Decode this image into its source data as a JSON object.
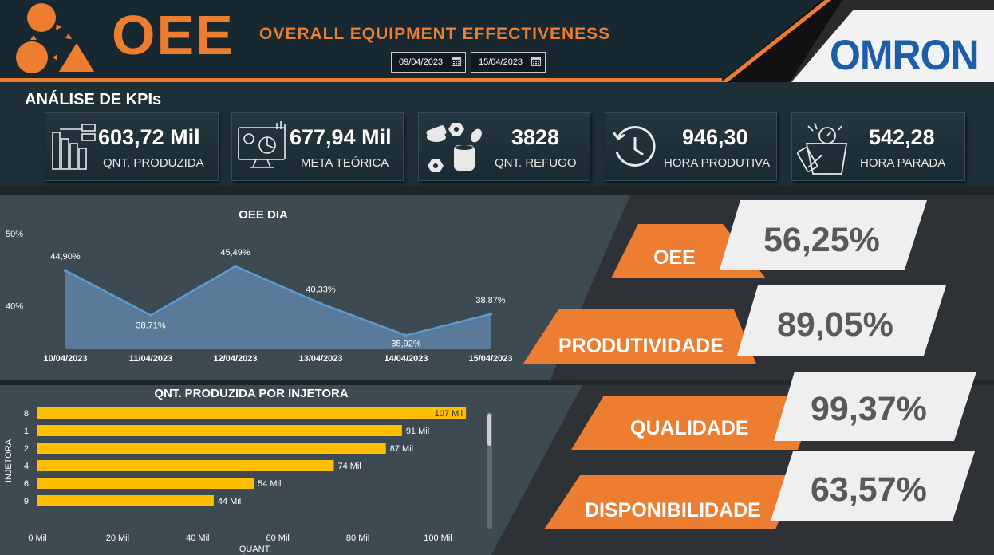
{
  "header": {
    "title": "OEE",
    "subtitle": "OVERALL EQUIPMENT EFFECTIVENESS",
    "date_start": "09/04/2023",
    "date_end": "15/04/2023",
    "brand": "OMRON",
    "accent_color": "#ed7d31",
    "brand_color": "#1d5ea8"
  },
  "kpis": {
    "title": "ANÁLISE DE KPIs",
    "cards": [
      {
        "value": "603,72 Mil",
        "label": "QNT. PRODUZIDA",
        "icon": "bar-chart-icon"
      },
      {
        "value": "677,94 Mil",
        "label": "META TEÓRICA",
        "icon": "monitor-chart-icon"
      },
      {
        "value": "3828",
        "label": "QNT. REFUGO",
        "icon": "parts-icon"
      },
      {
        "value": "946,30",
        "label": "HORA PRODUTIVA",
        "icon": "history-clock-icon"
      },
      {
        "value": "542,28",
        "label": "HORA PARADA",
        "icon": "stopwatch-icon"
      }
    ]
  },
  "chart_data": [
    {
      "type": "area",
      "title": "OEE DIA",
      "x": [
        "10/04/2023",
        "11/04/2023",
        "12/04/2023",
        "13/04/2023",
        "14/04/2023",
        "15/04/2023"
      ],
      "values": [
        44.9,
        38.71,
        45.49,
        40.33,
        35.92,
        38.87
      ],
      "data_labels": [
        "44,90%",
        "38,71%",
        "45,49%",
        "40,33%",
        "35,92%",
        "38,87%"
      ],
      "y_ticks": [
        "50%",
        "40%"
      ],
      "ylim": [
        34,
        50
      ],
      "grid": false,
      "color": "#5b9bd5"
    },
    {
      "type": "bar",
      "orientation": "horizontal",
      "title": "QNT. PRODUZIDA POR INJETORA",
      "xlabel": "QUANT.",
      "ylabel": "INJETORA",
      "categories": [
        "8",
        "1",
        "2",
        "4",
        "6",
        "9"
      ],
      "values": [
        107,
        91,
        87,
        74,
        54,
        44
      ],
      "data_labels": [
        "107 Mil",
        "91 Mil",
        "87 Mil",
        "74 Mil",
        "54 Mil",
        "44 Mil"
      ],
      "x_ticks": [
        "0 Mil",
        "20 Mil",
        "40 Mil",
        "60 Mil",
        "80 Mil",
        "100 Mil"
      ],
      "xlim": [
        0,
        107
      ],
      "grid": false,
      "color": "#ffbf00"
    }
  ],
  "metrics": [
    {
      "label": "OEE",
      "value": "56,25%"
    },
    {
      "label": "PRODUTIVIDADE",
      "value": "89,05%"
    },
    {
      "label": "QUALIDADE",
      "value": "99,37%"
    },
    {
      "label": "DISPONIBILIDADE",
      "value": "63,57%"
    }
  ]
}
